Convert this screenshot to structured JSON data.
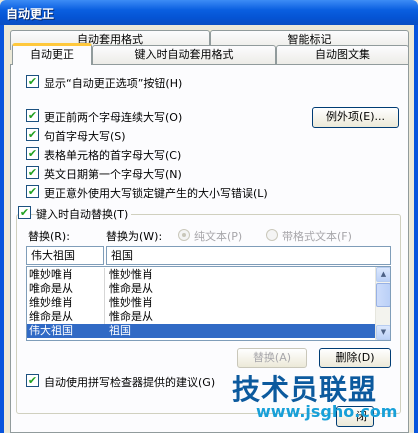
{
  "window": {
    "title": "自动更正"
  },
  "tabs_row1": [
    {
      "label": "自动套用格式"
    },
    {
      "label": "智能标记"
    }
  ],
  "tabs_row2": [
    {
      "label": "自动更正",
      "active": true
    },
    {
      "label": "键入时自动套用格式"
    },
    {
      "label": "自动图文集"
    }
  ],
  "options": {
    "show_buttons": {
      "label": "显示“自动更正选项”按钮(H)",
      "checked": true
    },
    "two_initial_caps": {
      "label": "更正前两个字母连续大写(O)",
      "checked": true
    },
    "capitalize_sentence": {
      "label": "句首字母大写(S)",
      "checked": true
    },
    "capitalize_table_cells": {
      "label": "表格单元格的首字母大写(C)",
      "checked": true
    },
    "capitalize_days": {
      "label": "英文日期第一个字母大写(N)",
      "checked": true
    },
    "caps_lock": {
      "label": "更正意外使用大写锁定键产生的大小写错误(L)",
      "checked": true
    },
    "replace_as_you_type": {
      "label": "键入时自动替换(T)",
      "checked": true
    },
    "spelling_checker": {
      "label": "自动使用拼写检查器提供的建议(G)",
      "checked": true
    }
  },
  "exceptions_button": "例外项(E)...",
  "replace_section": {
    "replace_label": "替换(R):",
    "with_label": "替换为(W):",
    "plain_text": "纯文本(P)",
    "formatted_text": "带格式文本(F)",
    "replace_value": "伟大祖国",
    "with_value": "祖国"
  },
  "entries": [
    {
      "replace": "唯妙唯肖",
      "with": "惟妙惟肖"
    },
    {
      "replace": "唯命是从",
      "with": "惟命是从"
    },
    {
      "replace": "维妙维肖",
      "with": "惟妙惟肖"
    },
    {
      "replace": "维命是从",
      "with": "惟命是从"
    },
    {
      "replace": "伟大祖国",
      "with": "祖国",
      "selected": true
    }
  ],
  "buttons": {
    "replace": "替换(A)",
    "delete": "删除(D)",
    "close_partial": "闭"
  },
  "watermark": {
    "main": "技术员联盟",
    "sub": "www.jsgho.com"
  },
  "colors": {
    "titlebar": "#0a5fe0",
    "selection": "#316ac5",
    "tab_highlight": "#ffc83c",
    "check": "#21a121"
  }
}
